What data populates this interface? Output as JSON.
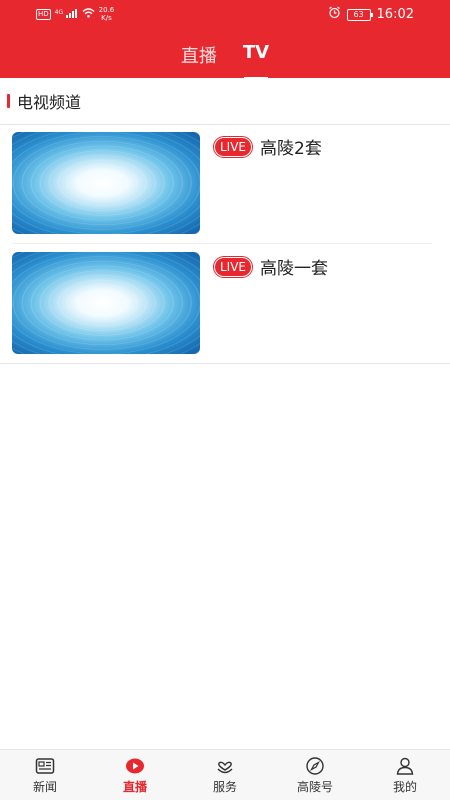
{
  "status": {
    "net_badge": "HD",
    "signal": "4G",
    "speed_value": "20.6",
    "speed_unit": "K/s",
    "battery": "63",
    "time": "16:02"
  },
  "tabs": [
    {
      "label": "直播",
      "active": false
    },
    {
      "label": "TV",
      "active": true
    }
  ],
  "section": {
    "title": "电视频道"
  },
  "channels": [
    {
      "badge": "LIVE",
      "name": "高陵2套"
    },
    {
      "badge": "LIVE",
      "name": "高陵一套"
    }
  ],
  "nav": [
    {
      "label": "新闻",
      "icon": "news-icon",
      "active": false
    },
    {
      "label": "直播",
      "icon": "play-icon",
      "active": true
    },
    {
      "label": "服务",
      "icon": "service-icon",
      "active": false
    },
    {
      "label": "高陵号",
      "icon": "compass-icon",
      "active": false
    },
    {
      "label": "我的",
      "icon": "user-icon",
      "active": false
    }
  ],
  "colors": {
    "accent": "#e8282f"
  }
}
